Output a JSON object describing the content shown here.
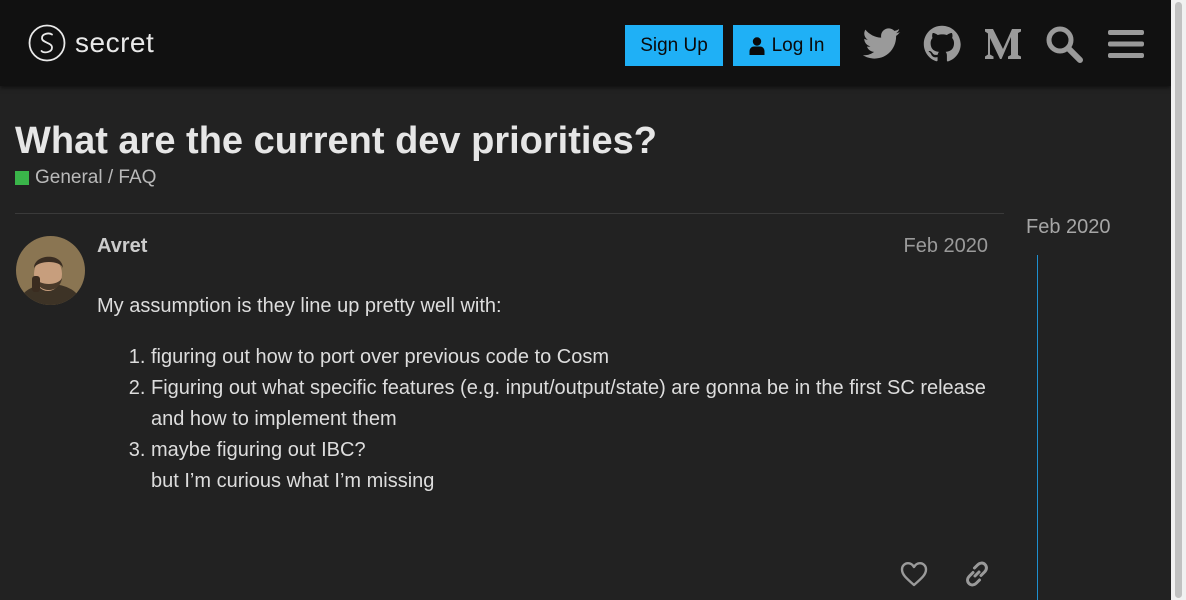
{
  "header": {
    "logo_text": "secret",
    "signup_label": "Sign Up",
    "login_label": "Log In",
    "icons": [
      "twitter-icon",
      "github-icon",
      "medium-icon",
      "search-icon",
      "hamburger-menu-icon"
    ]
  },
  "topic": {
    "title": "What are the current dev priorities?",
    "category": "General / FAQ",
    "category_color": "#3ab54a"
  },
  "post": {
    "username": "Avret",
    "date": "Feb 2020",
    "intro": "My assumption is they line up pretty well with:",
    "items": [
      "figuring out how to port over previous code to Cosm",
      "Figuring out what specific features (e.g. input/output/state) are gonna be in the first SC release and how to implement them",
      "maybe figuring out IBC?"
    ],
    "item3_continuation": "but I’m curious what I’m missing"
  },
  "timeline": {
    "label": "Feb 2020"
  },
  "colors": {
    "accent": "#1fb0f6",
    "timeline": "#1e8fcf",
    "background": "#222222",
    "header": "#111111"
  }
}
